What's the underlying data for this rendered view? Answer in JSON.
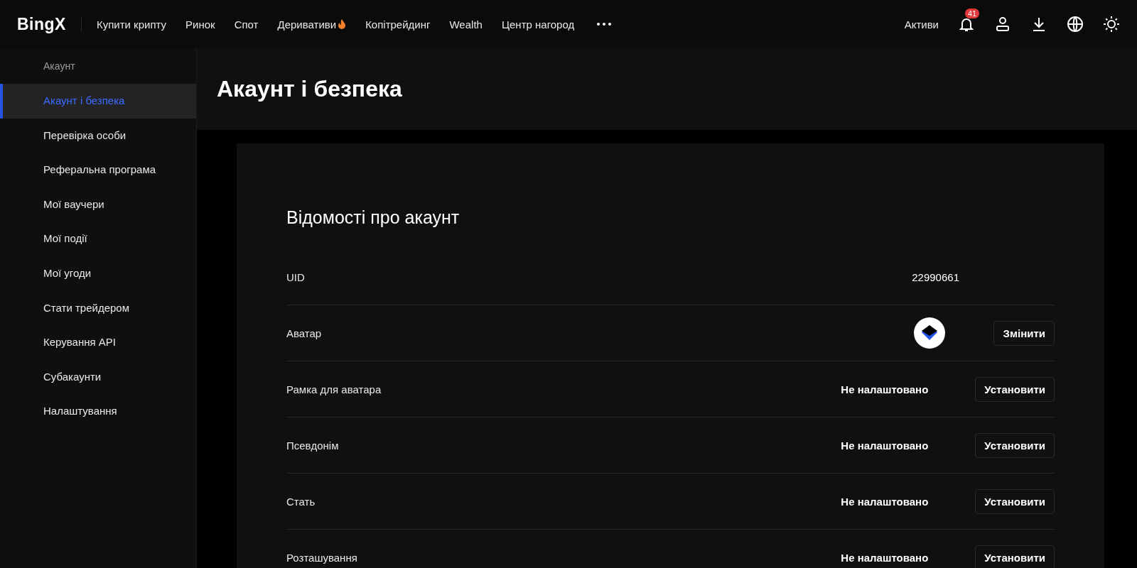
{
  "header": {
    "logo": "BingX",
    "nav": [
      {
        "label": "Купити крипту",
        "hot": false
      },
      {
        "label": "Ринок",
        "hot": false
      },
      {
        "label": "Спот",
        "hot": false
      },
      {
        "label": "Деривативи",
        "hot": true
      },
      {
        "label": "Копітрейдинг",
        "hot": false
      },
      {
        "label": "Wealth",
        "hot": false
      },
      {
        "label": "Центр нагород",
        "hot": false
      }
    ],
    "assets": "Активи",
    "notification_count": "41"
  },
  "sidebar": {
    "section": "Акаунт",
    "items": [
      {
        "label": "Акаунт і безпека",
        "selected": true
      },
      {
        "label": "Перевірка особи",
        "selected": false
      },
      {
        "label": "Реферальна програма",
        "selected": false
      },
      {
        "label": "Мої ваучери",
        "selected": false
      },
      {
        "label": "Мої події",
        "selected": false
      },
      {
        "label": "Мої угоди",
        "selected": false
      },
      {
        "label": "Стати трейдером",
        "selected": false
      },
      {
        "label": "Керування API",
        "selected": false
      },
      {
        "label": "Субакаунти",
        "selected": false
      },
      {
        "label": "Налаштування",
        "selected": false
      }
    ]
  },
  "page_title": "Акаунт і безпека",
  "card": {
    "title": "Відомості про акаунт",
    "rows": [
      {
        "kind": "text",
        "label": "UID",
        "value": "22990661"
      },
      {
        "kind": "avatar",
        "label": "Аватар",
        "button": "Змінити"
      },
      {
        "kind": "setting",
        "label": "Рамка для аватара",
        "value": "Не налаштовано",
        "button": "Установити"
      },
      {
        "kind": "setting",
        "label": "Псевдонім",
        "value": "Не налаштовано",
        "button": "Установити"
      },
      {
        "kind": "setting",
        "label": "Стать",
        "value": "Не налаштовано",
        "button": "Установити"
      },
      {
        "kind": "setting",
        "label": "Розташування",
        "value": "Не налаштовано",
        "button": "Установити"
      }
    ]
  }
}
